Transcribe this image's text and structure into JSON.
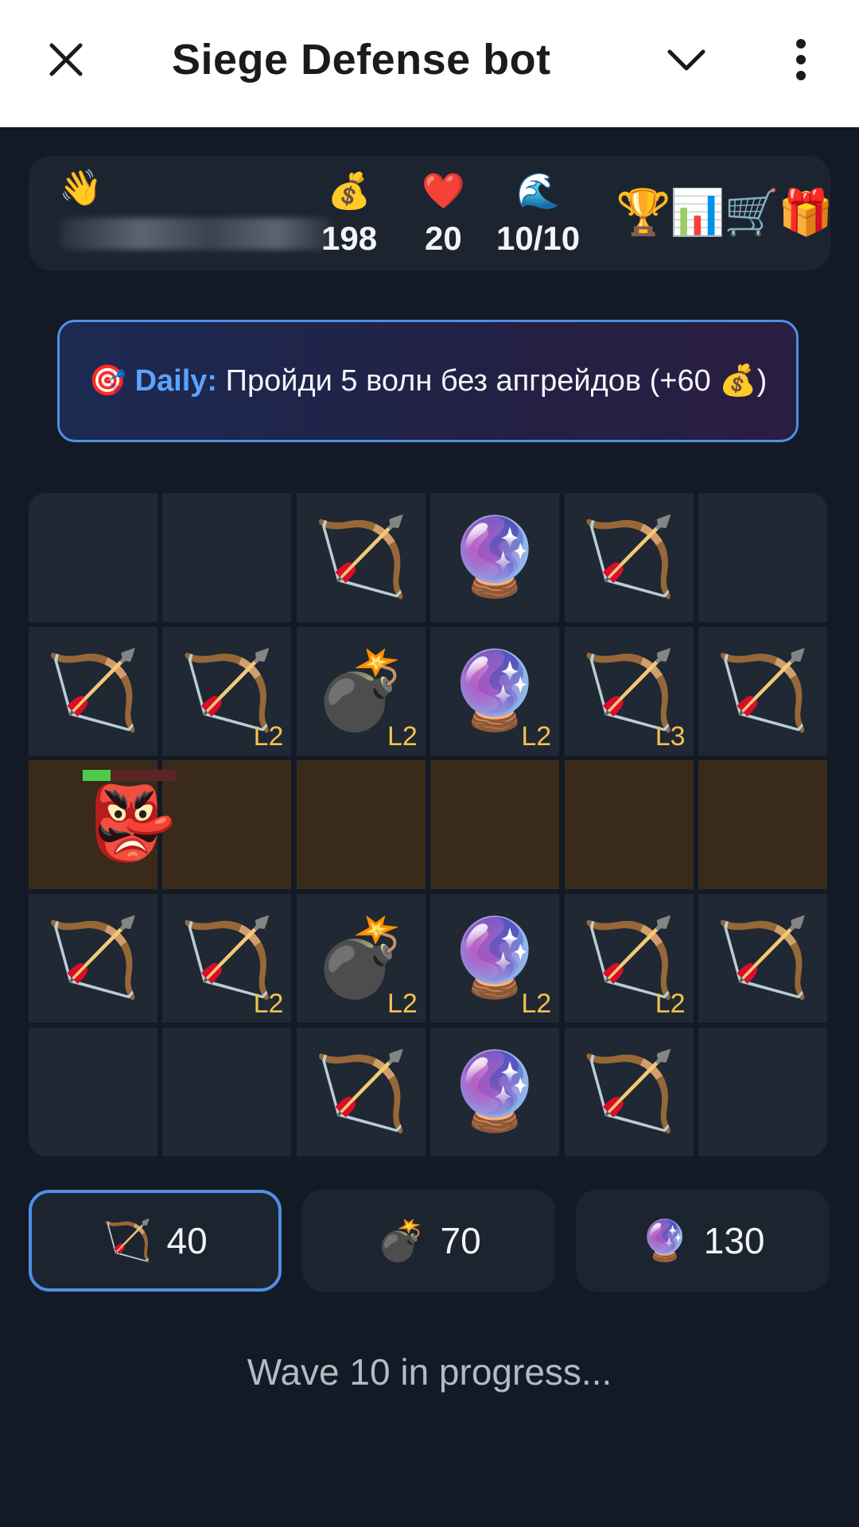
{
  "appbar": {
    "title": "Siege Defense bot",
    "close_icon": "close-icon",
    "chevron_icon": "chevron-down-icon",
    "more_icon": "more-vertical-icon"
  },
  "stats": {
    "greeting_emoji": "👋",
    "gold_icon": "💰",
    "gold": "198",
    "lives_icon": "❤️",
    "lives": "20",
    "wave_icon": "🌊",
    "wave": "10/10",
    "menu": [
      {
        "name": "leaderboard-icon",
        "emoji": "🏆"
      },
      {
        "name": "stats-icon",
        "emoji": "📊"
      },
      {
        "name": "shop-cart-icon",
        "emoji": "🛒"
      },
      {
        "name": "gift-icon",
        "emoji": "🎁"
      }
    ]
  },
  "daily": {
    "emoji": "🎯",
    "label": "Daily:",
    "text": "Пройди 5 волн без апгрейдов (+60 💰)"
  },
  "board": {
    "rows": [
      [
        {
          "tower": ""
        },
        {
          "tower": ""
        },
        {
          "tower": "bow",
          "level": ""
        },
        {
          "tower": "orb",
          "level": ""
        },
        {
          "tower": "bow",
          "level": ""
        },
        {
          "tower": ""
        }
      ],
      [
        {
          "tower": "bow",
          "level": ""
        },
        {
          "tower": "bow",
          "level": "L2"
        },
        {
          "tower": "bomb",
          "level": "L2"
        },
        {
          "tower": "orb",
          "level": "L2"
        },
        {
          "tower": "bow",
          "level": "L3"
        },
        {
          "tower": "bow",
          "level": ""
        }
      ],
      [
        {
          "path": true
        },
        {
          "path": true
        },
        {
          "path": true
        },
        {
          "path": true
        },
        {
          "path": true
        },
        {
          "path": true
        }
      ],
      [
        {
          "tower": "bow",
          "level": ""
        },
        {
          "tower": "bow",
          "level": "L2"
        },
        {
          "tower": "bomb",
          "level": "L2"
        },
        {
          "tower": "orb",
          "level": "L2"
        },
        {
          "tower": "bow",
          "level": "L2"
        },
        {
          "tower": "bow",
          "level": ""
        }
      ],
      [
        {
          "tower": ""
        },
        {
          "tower": ""
        },
        {
          "tower": "bow",
          "level": ""
        },
        {
          "tower": "orb",
          "level": ""
        },
        {
          "tower": "bow",
          "level": ""
        },
        {
          "tower": ""
        }
      ]
    ],
    "tower_emoji": {
      "bow": "🏹",
      "bomb": "💣",
      "orb": "🔮"
    },
    "enemy": {
      "emoji": "👺",
      "name": "goblin-enemy",
      "hp_fraction": 0.3,
      "row": 2,
      "col": 0
    }
  },
  "shop": [
    {
      "name": "bow-tower-button",
      "icon": "🏹",
      "price": "40",
      "selected": true
    },
    {
      "name": "bomb-tower-button",
      "icon": "💣",
      "price": "70",
      "selected": false
    },
    {
      "name": "orb-tower-button",
      "icon": "🔮",
      "price": "130",
      "selected": false
    }
  ],
  "status": "Wave 10 in progress..."
}
